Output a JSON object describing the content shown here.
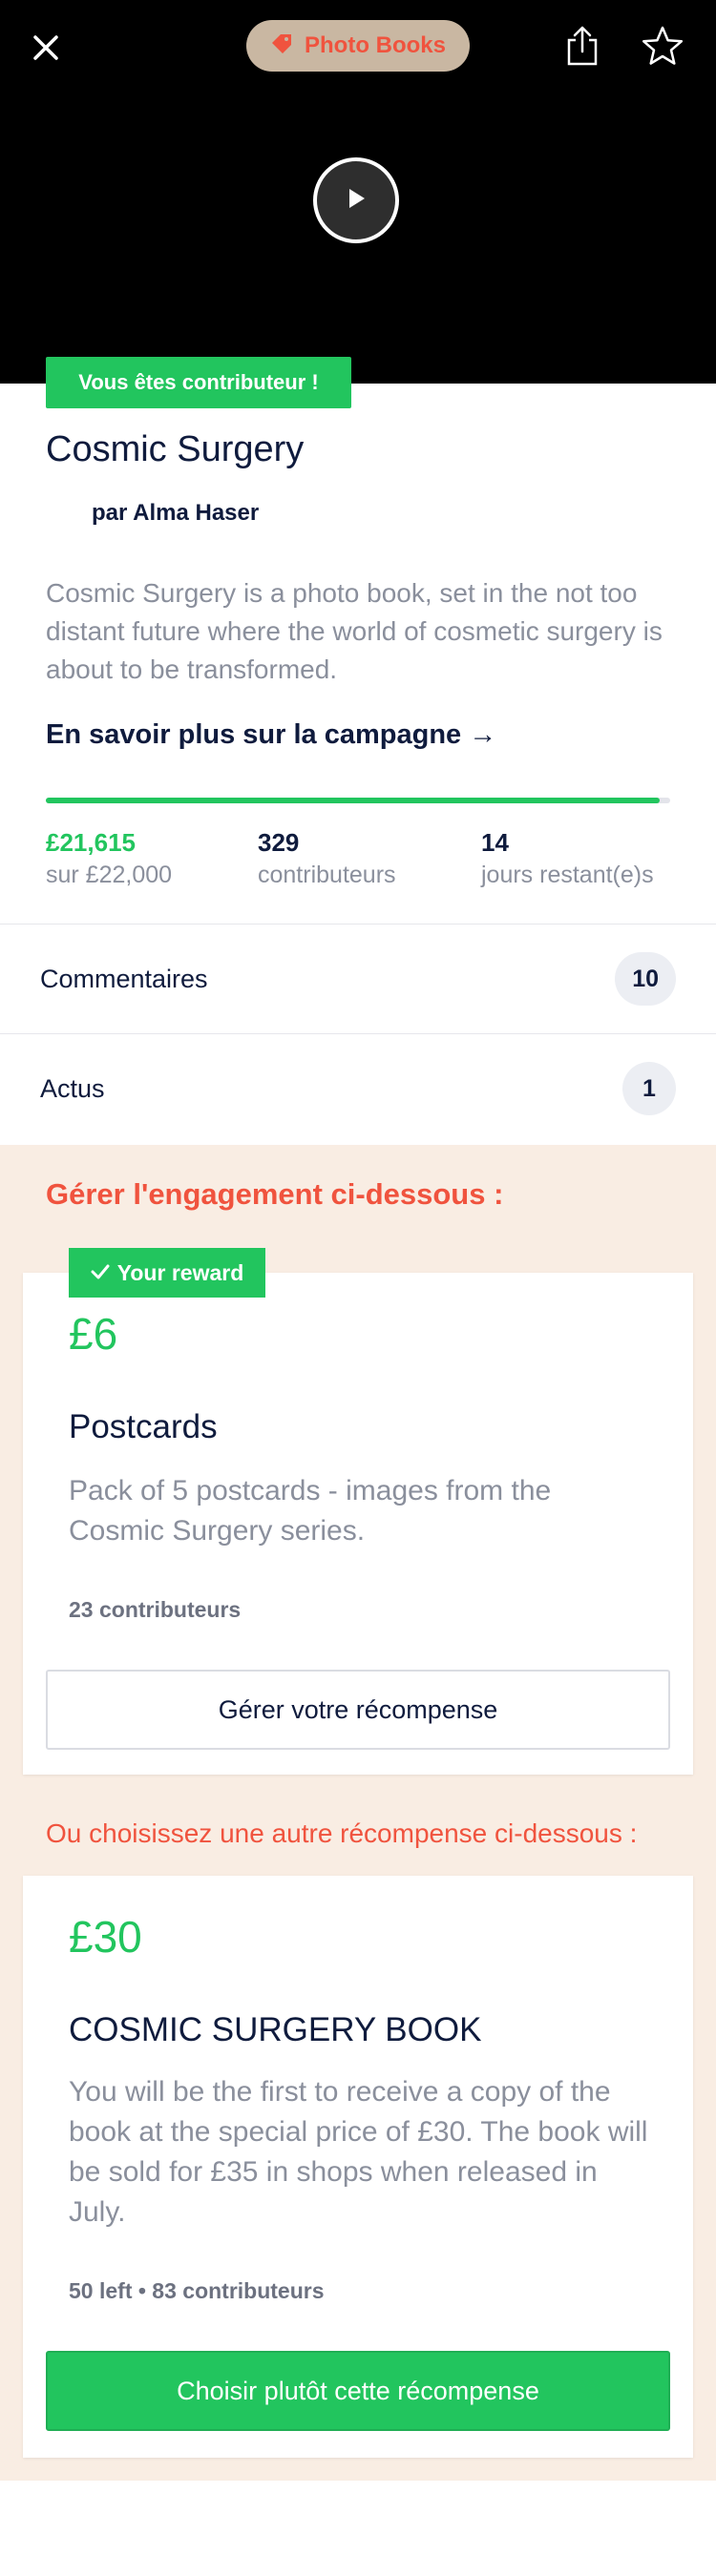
{
  "header": {
    "category_label": "Photo Books",
    "close_icon": "close-icon",
    "share_icon": "share-icon",
    "star_icon": "star-icon",
    "play_icon": "play-icon",
    "category_icon": "tag-icon"
  },
  "project": {
    "contributor_badge": "Vous êtes contributeur !",
    "title": "Cosmic Surgery",
    "author": "par Alma Haser",
    "description": "Cosmic Surgery is a photo book, set in the not too distant future where the world of cosmetic surgery is about to be transformed.",
    "learn_more": "En savoir plus sur la campagne →",
    "progress_fraction": 0.9825
  },
  "stats": {
    "raised_value": "£21,615",
    "raised_label": "sur £22,000",
    "backers_value": "329",
    "backers_label": "contributeurs",
    "days_value": "14",
    "days_label": "jours restant(e)s"
  },
  "rows": {
    "comments_label": "Commentaires",
    "comments_count": "10",
    "updates_label": "Actus",
    "updates_count": "1"
  },
  "rewards": {
    "manage_heading": "Gérer l'engagement ci-dessous :",
    "current": {
      "badge": "Your reward",
      "price": "£6",
      "title": "Postcards",
      "description": "Pack of 5 postcards - images from the Cosmic Surgery series.",
      "meta": "23 contributeurs",
      "button": "Gérer votre récompense"
    },
    "other_heading": "Ou choisissez une autre récompense ci-dessous :",
    "other": {
      "price": "£30",
      "title": "COSMIC SURGERY BOOK",
      "description": "You will be the first to receive a copy of the book at the special price of £30. The book will be sold for £35 in shops when released in July.",
      "meta": "50 left • 83 contributeurs",
      "button": "Choisir plutôt cette récompense"
    }
  },
  "colors": {
    "accent_green": "#22c55e",
    "accent_red": "#f0533e",
    "navy_text": "#0f1b3d",
    "rewards_bg": "#f9ede3"
  }
}
